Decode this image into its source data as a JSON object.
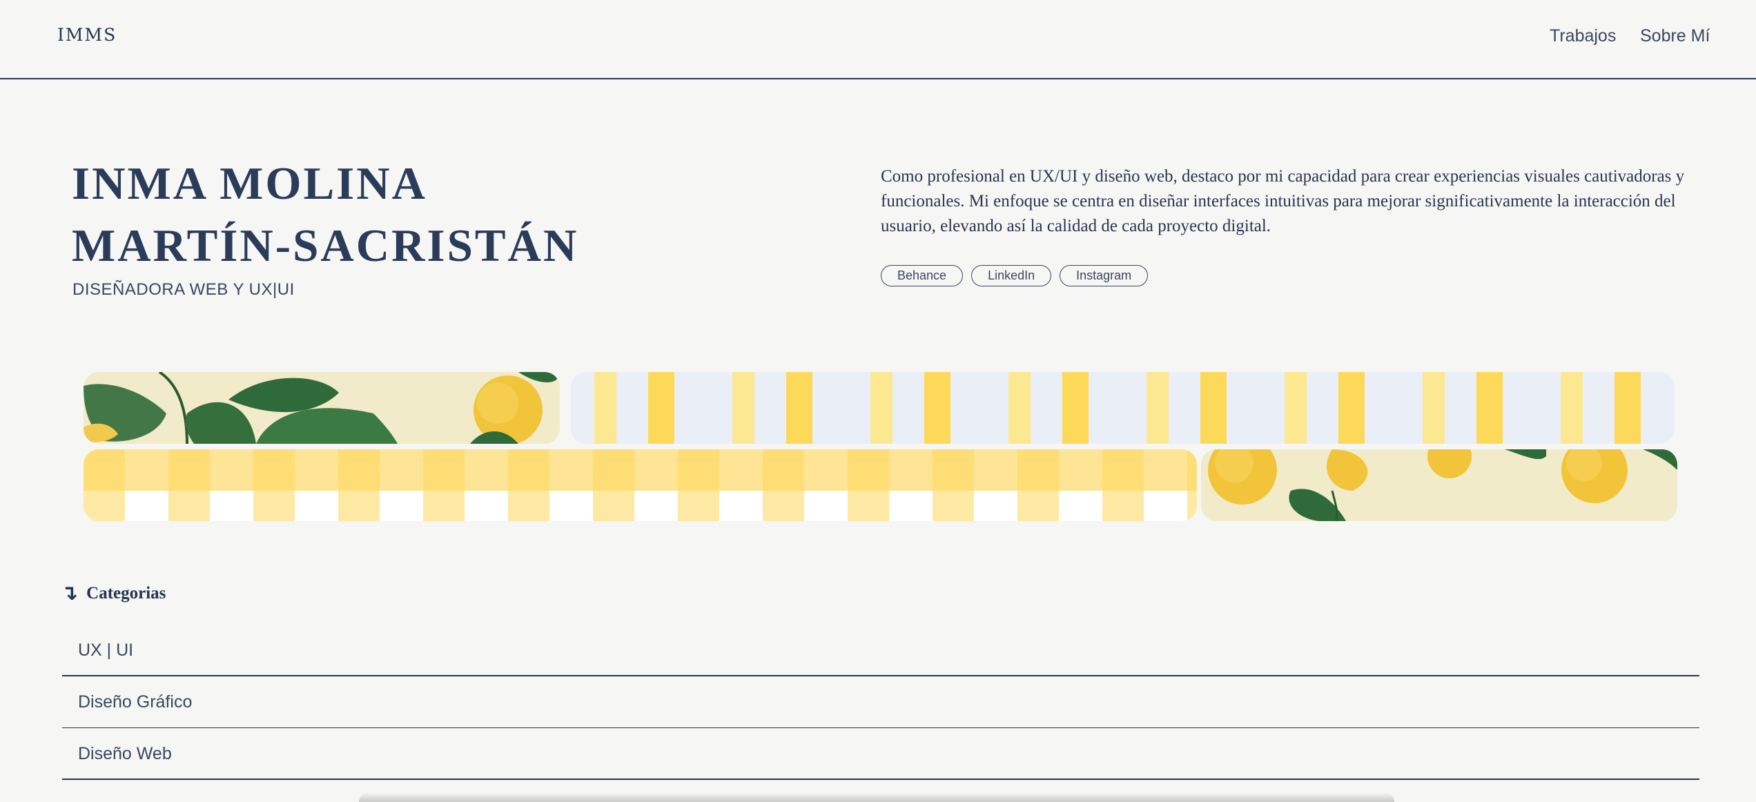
{
  "header": {
    "logo": "IMMS",
    "nav": [
      "Trabajos",
      "Sobre Mí"
    ]
  },
  "hero": {
    "name_line1": "INMA MOLINA",
    "name_line2": "MARTÍN-SACRISTÁN",
    "subtitle": "DISEÑADORA WEB Y UX|UI",
    "bio": "Como profesional en UX/UI y diseño web, destaco por mi capacidad para crear experiencias visuales cautivadoras y funcionales. Mi enfoque se centra en diseñar interfaces intuitivas para mejorar significativamente la interacción del usuario, elevando así la calidad de cada proyecto digital.",
    "socials": [
      "Behance",
      "LinkedIn",
      "Instagram"
    ]
  },
  "gallery": {
    "tiles": [
      {
        "pattern": "lemon-leaves-illustration"
      },
      {
        "pattern": "yellow-vertical-stripes"
      },
      {
        "pattern": "yellow-gingham"
      },
      {
        "pattern": "lemons-illustration"
      }
    ]
  },
  "categories": {
    "heading": "Categorias",
    "icon": "arrow-down-return-icon",
    "items": [
      "UX | UI",
      "Diseño Gráfico",
      "Diseño Web"
    ]
  },
  "colors": {
    "background": "#f6f6f4",
    "navy": "#253450",
    "lemon_yellow": "#fdd95a",
    "leaf_green": "#2f6b3a"
  }
}
